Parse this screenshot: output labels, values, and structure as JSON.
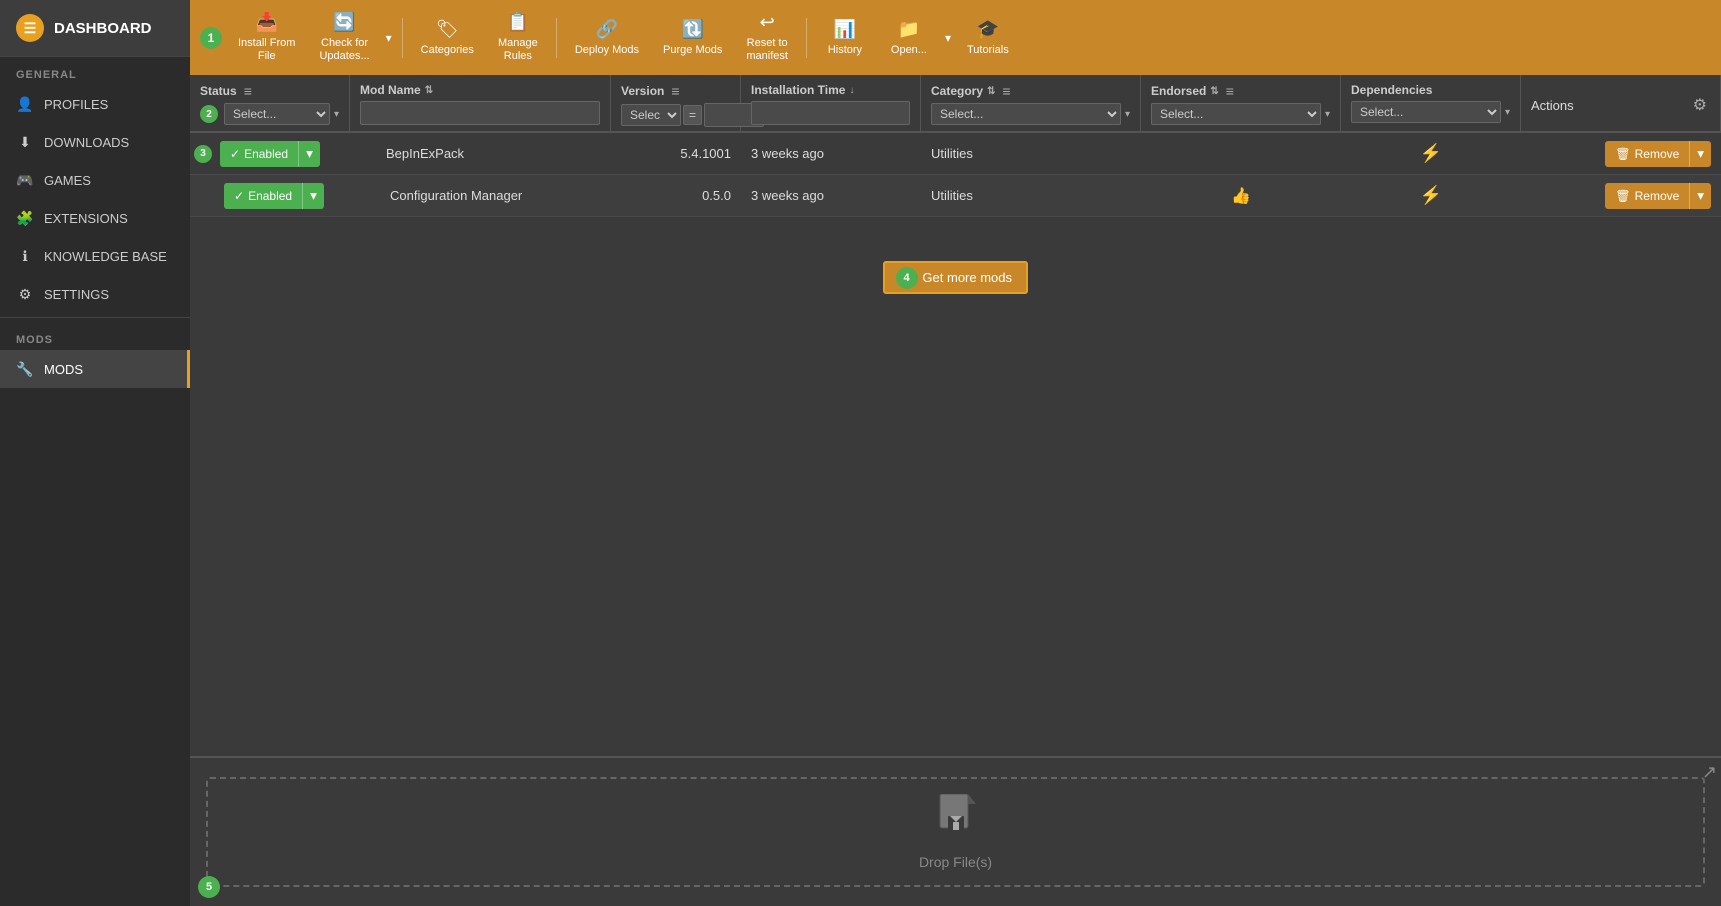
{
  "sidebar": {
    "logo": "DASHBOARD",
    "sections": [
      {
        "label": "GENERAL",
        "items": [
          {
            "id": "profiles",
            "label": "PROFILES",
            "icon": "👤"
          },
          {
            "id": "downloads",
            "label": "DOWNLOADS",
            "icon": "⬇"
          },
          {
            "id": "games",
            "label": "GAMES",
            "icon": "🎮"
          },
          {
            "id": "extensions",
            "label": "EXTENSIONS",
            "icon": "🧩"
          },
          {
            "id": "knowledge-base",
            "label": "KNOWLEDGE BASE",
            "icon": "ℹ"
          },
          {
            "id": "settings",
            "label": "SETTINGS",
            "icon": "⚙"
          }
        ]
      },
      {
        "label": "MODS",
        "items": [
          {
            "id": "mods",
            "label": "MODS",
            "icon": "🔧",
            "active": true
          }
        ]
      }
    ]
  },
  "toolbar": {
    "buttons": [
      {
        "id": "install-from-file",
        "label": "Install From\nFile",
        "icon": "📥"
      },
      {
        "id": "check-for-updates",
        "label": "Check for\nUpdates...",
        "icon": "🔄",
        "dropdown": true
      },
      {
        "id": "categories",
        "label": "Categories",
        "icon": "🏷"
      },
      {
        "id": "manage-rules",
        "label": "Manage\nRules",
        "icon": "📋"
      },
      {
        "id": "deploy-mods",
        "label": "Deploy Mods",
        "icon": "🔗"
      },
      {
        "id": "purge-mods",
        "label": "Purge Mods",
        "icon": "🔃"
      },
      {
        "id": "reset-to-manifest",
        "label": "Reset to\nmanifest",
        "icon": "↩"
      },
      {
        "id": "history",
        "label": "History",
        "icon": "📊"
      },
      {
        "id": "open",
        "label": "Open...",
        "icon": "📁",
        "dropdown": true
      },
      {
        "id": "tutorials",
        "label": "Tutorials",
        "icon": "🎓"
      }
    ]
  },
  "table": {
    "columns": [
      {
        "id": "status",
        "label": "Status",
        "filter_type": "select",
        "filter_placeholder": "Select...",
        "has_icon": true
      },
      {
        "id": "modname",
        "label": "Mod Name",
        "filter_type": "text",
        "sortable": true
      },
      {
        "id": "version",
        "label": "Version",
        "filter_type": "select",
        "filter_placeholder": "Select...",
        "has_icon": true
      },
      {
        "id": "installtime",
        "label": "Installation Time",
        "filter_type": "text",
        "sortable": true,
        "sort_dir": "desc"
      },
      {
        "id": "category",
        "label": "Category",
        "filter_type": "select",
        "filter_placeholder": "Select...",
        "has_icon": true,
        "sortable": true
      },
      {
        "id": "endorsed",
        "label": "Endorsed",
        "filter_type": "select",
        "filter_placeholder": "Select...",
        "has_icon": true,
        "sortable": true
      },
      {
        "id": "dependencies",
        "label": "Dependencies",
        "filter_type": "select",
        "filter_placeholder": "Select..."
      },
      {
        "id": "actions",
        "label": "Actions"
      }
    ],
    "rows": [
      {
        "status": "Enabled",
        "modname": "BepInExPack",
        "version": "5.4.1001",
        "installtime": "3 weeks ago",
        "category": "Utilities",
        "endorsed": "",
        "dependencies": "",
        "has_endorsed_icon": false
      },
      {
        "status": "Enabled",
        "modname": "Configuration Manager",
        "version": "0.5.0",
        "installtime": "3 weeks ago",
        "category": "Utilities",
        "endorsed": "👍",
        "dependencies": "",
        "has_endorsed_icon": true
      }
    ]
  },
  "get_more_mods": "Get more mods",
  "drop_zone": {
    "label": "Drop File(s)"
  },
  "filter": {
    "version_equals": "=",
    "status_select": "Select...",
    "version_select": "Select...",
    "install_time_val": "",
    "category_select": "Select...",
    "endorsed_select": "Select...",
    "dependencies_select": "Select..."
  },
  "badges": {
    "b1": "1",
    "b2": "2",
    "b3": "3",
    "b4": "4",
    "b5": "5"
  },
  "labels": {
    "enabled": "Enabled",
    "remove": "Remove",
    "checkmark": "✓"
  }
}
